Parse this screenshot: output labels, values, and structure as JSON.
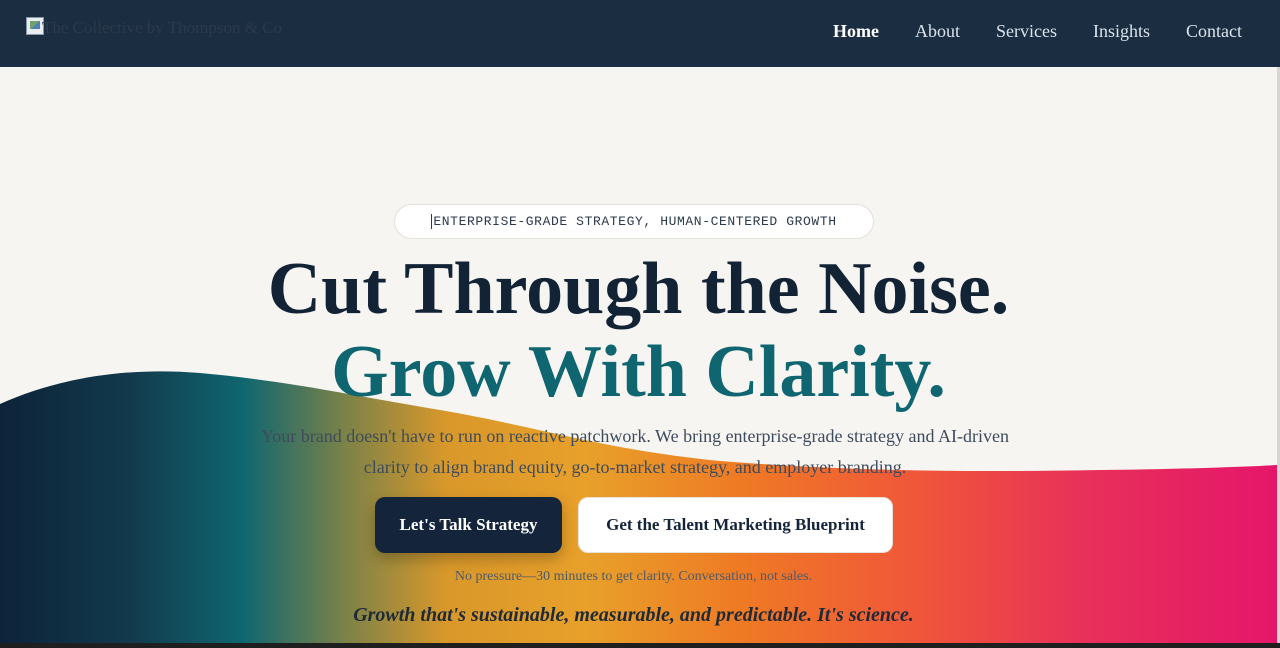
{
  "nav": {
    "logo_alt": "The Collective by Thompson & Co",
    "links": [
      {
        "label": "Home",
        "active": true
      },
      {
        "label": "About",
        "active": false
      },
      {
        "label": "Services",
        "active": false
      },
      {
        "label": "Insights",
        "active": false
      },
      {
        "label": "Contact",
        "active": false
      }
    ]
  },
  "hero": {
    "eyebrow": "ENTERPRISE-GRADE STRATEGY, HUMAN-CENTERED GROWTH",
    "headline_line1": "Cut Through the Noise.",
    "headline_line2": "Grow With Clarity.",
    "lead": "Your brand doesn't have to run on reactive patchwork. We bring enterprise-grade strategy and AI-driven clarity to align brand equity, go-to-market strategy, and employer branding.",
    "primary_cta": "Let's Talk Strategy",
    "secondary_cta": "Get the Talent Marketing Blueprint",
    "note": "No pressure—30 minutes to get clarity. Conversation, not sales.",
    "tagline": "Growth that's sustainable, measurable, and predictable. It's science."
  },
  "colors": {
    "nav_bg": "#1b2d40",
    "hero_bg": "#f7f5f2",
    "navy": "#14243a",
    "teal": "#0f6670",
    "gold": "#d9982a",
    "orange": "#ef7a24",
    "magenta": "#e5166a"
  }
}
